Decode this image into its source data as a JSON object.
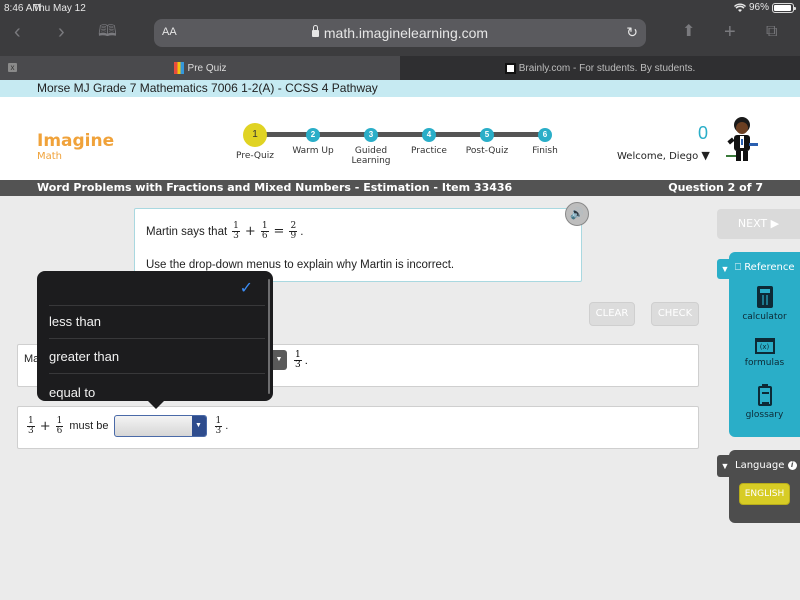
{
  "status_bar": {
    "time": "8:46 AM",
    "date": "Thu May 12",
    "battery_text": "96%",
    "battery_level": 0.96
  },
  "browser": {
    "text_size_label": "AA",
    "url": "math.imaginelearning.com",
    "tabs": [
      {
        "label": "Pre Quiz",
        "active": true
      },
      {
        "label": "Brainly.com - For students. By students.",
        "active": false
      }
    ],
    "close_tab_label": "x"
  },
  "course": {
    "title": "Morse MJ Grade 7 Mathematics 7006 1-2(A) - CCSS 4 Pathway"
  },
  "header": {
    "logo_main": "Imagine",
    "logo_sub": "Math",
    "steps": [
      {
        "num": "1",
        "label": "Pre-Quiz",
        "current": true
      },
      {
        "num": "2",
        "label": "Warm Up",
        "current": false
      },
      {
        "num": "3",
        "label": "Guided Learning",
        "current": false
      },
      {
        "num": "4",
        "label": "Practice",
        "current": false
      },
      {
        "num": "5",
        "label": "Post-Quiz",
        "current": false
      },
      {
        "num": "6",
        "label": "Finish",
        "current": false
      }
    ],
    "score": "0",
    "welcome": "Welcome, Diego",
    "welcome_caret": "▼"
  },
  "titlebar": {
    "title": "Word Problems with Fractions and Mixed Numbers - Estimation - Item 33436",
    "question": "Question 2 of 7"
  },
  "question": {
    "intro": "Martin says that",
    "eq": {
      "a": {
        "n": "1",
        "d": "3"
      },
      "op1": "+",
      "b": {
        "n": "1",
        "d": "6"
      },
      "op2": "=",
      "c": {
        "n": "2",
        "d": "9"
      },
      "end": "."
    },
    "instruction": "Use the drop-down menus to explain why Martin is incorrect."
  },
  "buttons": {
    "clear": "CLEAR",
    "check": "CHECK",
    "next": "NEXT ▶"
  },
  "answers": {
    "row1": {
      "prefix_visible": "Ma",
      "frac": {
        "n": "1",
        "d": "3"
      },
      "end": "."
    },
    "row2": {
      "a": {
        "n": "1",
        "d": "3"
      },
      "op": "+",
      "b": {
        "n": "1",
        "d": "6"
      },
      "text": "must be",
      "selected": "",
      "c": {
        "n": "1",
        "d": "3"
      },
      "end": "."
    }
  },
  "popover": {
    "options": [
      {
        "label": "",
        "checked": true
      },
      {
        "label": "less than",
        "checked": false
      },
      {
        "label": "greater than",
        "checked": false
      },
      {
        "label": "equal to",
        "checked": false
      }
    ],
    "check_glyph": "✓"
  },
  "reference": {
    "title": "Reference",
    "items": [
      {
        "label": "calculator",
        "icon": "calculator-icon"
      },
      {
        "label": "formulas",
        "icon": "formulas-icon"
      },
      {
        "label": "glossary",
        "icon": "glossary-icon"
      }
    ],
    "formula_glyph": "(x)"
  },
  "language": {
    "title": "Language",
    "button": "ENGLISH"
  },
  "colors": {
    "accent_teal": "#2aaec8",
    "logo_orange": "#f0a23a",
    "current_step_yellow": "#e0d323",
    "english_yellow": "#d7cc25",
    "title_bar": "#535353"
  }
}
